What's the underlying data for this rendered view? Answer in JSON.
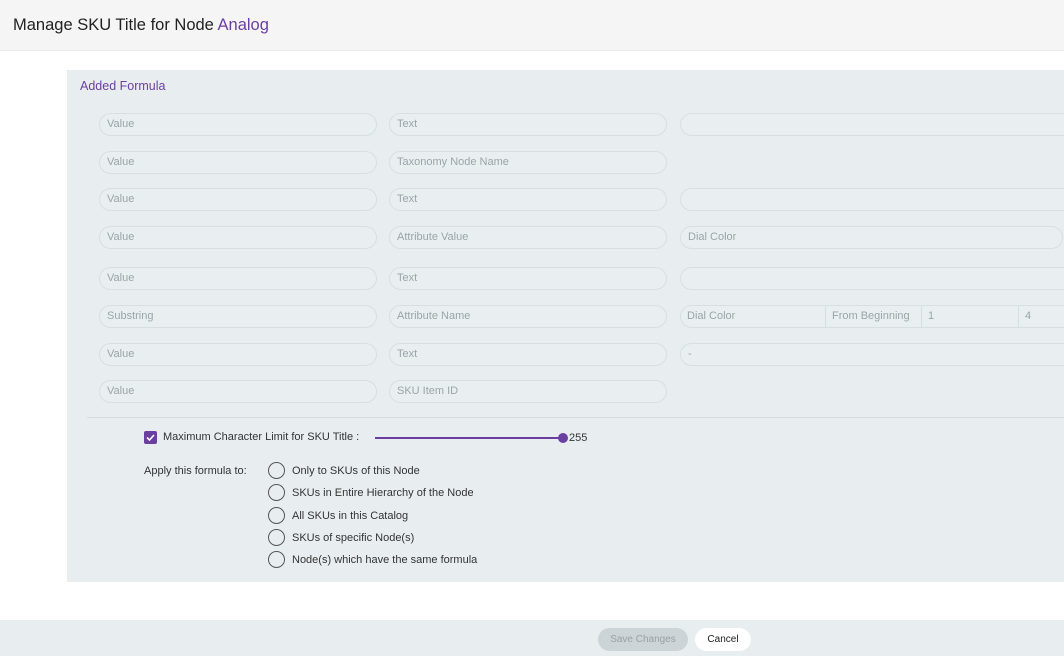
{
  "header": {
    "title_prefix": "Manage SKU Title for Node ",
    "node_name": "Analog"
  },
  "panel": {
    "title": "Added Formula",
    "rows": [
      {
        "c1": "Value",
        "c2": "Text",
        "c3": ""
      },
      {
        "c1": "Value",
        "c2": "Taxonomy Node Name"
      },
      {
        "c1": "Value",
        "c2": "Text",
        "c3": ""
      },
      {
        "c1": "Value",
        "c2": "Attribute Value",
        "c3": "Dial Color"
      },
      {
        "c1": "Value",
        "c2": "Text",
        "c3": ""
      },
      {
        "c1": "Substring",
        "c2": "Attribute Name",
        "c3": "Dial Color",
        "c4": "From Beginning",
        "c5": "1",
        "c6": "4"
      },
      {
        "c1": "Value",
        "c2": "Text",
        "c3": "-"
      },
      {
        "c1": "Value",
        "c2": "SKU Item ID"
      }
    ]
  },
  "limit": {
    "checked": true,
    "label": "Maximum Character Limit for SKU Title :",
    "value": "255"
  },
  "apply": {
    "label": "Apply this formula to:",
    "options": [
      "Only to SKUs of this Node",
      "SKUs in Entire Hierarchy of the Node",
      "All SKUs in this Catalog",
      "SKUs of specific Node(s)",
      "Node(s) which have the same formula"
    ]
  },
  "footer": {
    "save_label": "Save Changes",
    "cancel_label": "Cancel"
  },
  "colors": {
    "accent": "#6b3fa0",
    "panel_bg": "#e8eef0"
  }
}
